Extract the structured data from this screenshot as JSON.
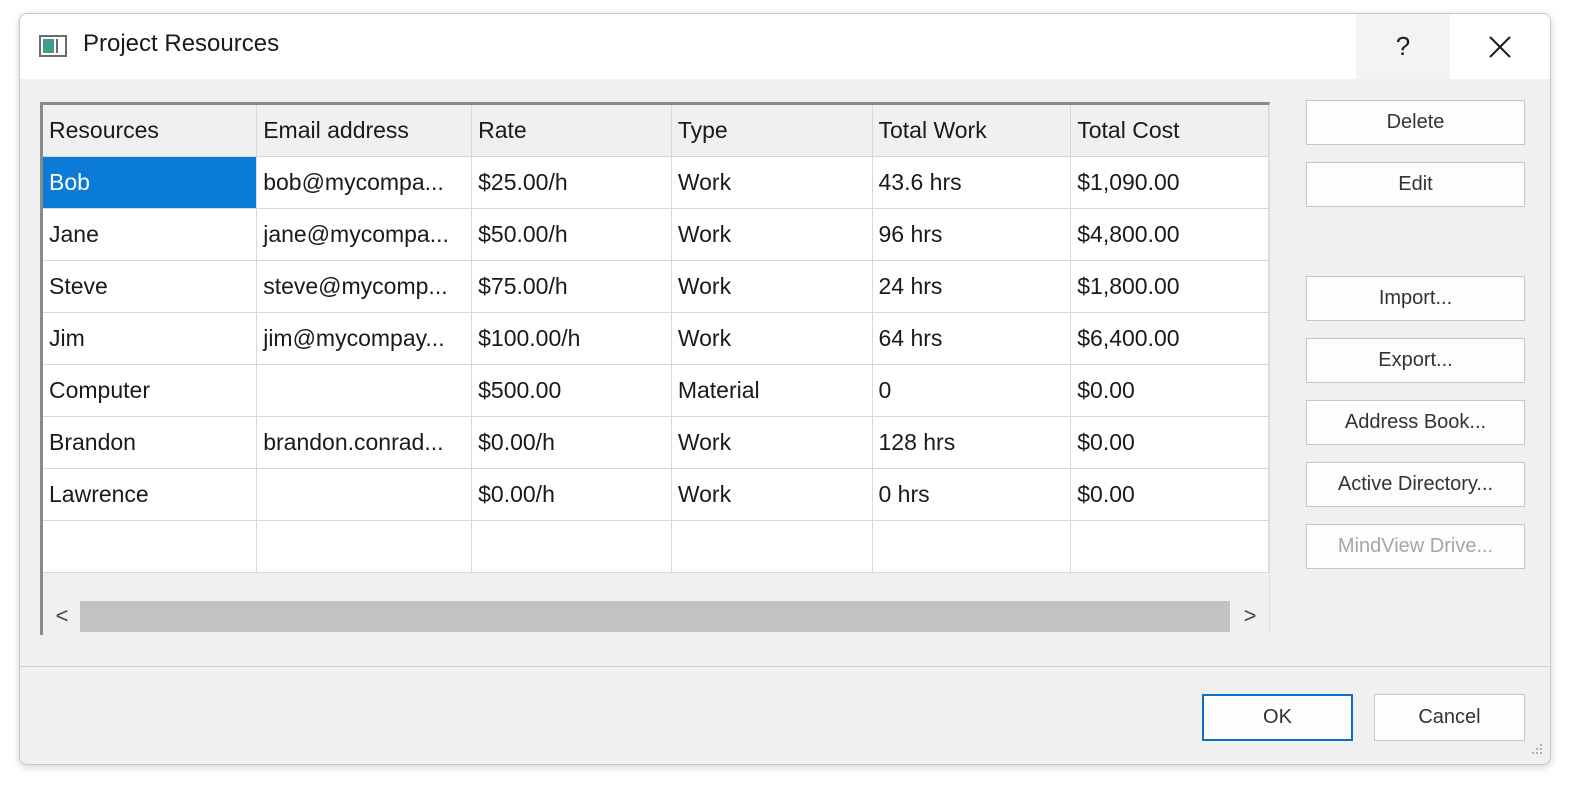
{
  "window": {
    "title": "Project Resources",
    "help_label": "?",
    "close_icon": "close-icon"
  },
  "table": {
    "columns": [
      "Resources",
      "Email address",
      "Rate",
      "Type",
      "Total Work",
      "Total Cost"
    ],
    "rows": [
      [
        "Bob",
        "bob@mycompa...",
        "$25.00/h",
        "Work",
        "43.6 hrs",
        "$1,090.00"
      ],
      [
        "Jane",
        "jane@mycompa...",
        "$50.00/h",
        "Work",
        "96 hrs",
        "$4,800.00"
      ],
      [
        "Steve",
        "steve@mycomp...",
        "$75.00/h",
        "Work",
        "24 hrs",
        "$1,800.00"
      ],
      [
        "Jim",
        "jim@mycompay...",
        "$100.00/h",
        "Work",
        "64 hrs",
        "$6,400.00"
      ],
      [
        "Computer",
        "",
        "$500.00",
        "Material",
        "0",
        "$0.00"
      ],
      [
        "Brandon",
        "brandon.conrad...",
        "$0.00/h",
        "Work",
        "128 hrs",
        "$0.00"
      ],
      [
        "Lawrence",
        "",
        "$0.00/h",
        "Work",
        "0 hrs",
        "$0.00"
      ],
      [
        "",
        "",
        "",
        "",
        "",
        ""
      ]
    ],
    "selected_cell": "Bob",
    "scroll_left": "<",
    "scroll_right": ">"
  },
  "side_buttons": {
    "delete": "Delete",
    "edit": "Edit",
    "import": "Import...",
    "export": "Export...",
    "address_book": "Address Book...",
    "active_directory": "Active Directory...",
    "mindview_drive": "MindView Drive..."
  },
  "footer": {
    "ok": "OK",
    "cancel": "Cancel"
  },
  "colors": {
    "selection": "#0a7bd7",
    "ok_border": "#0a6fc7"
  }
}
